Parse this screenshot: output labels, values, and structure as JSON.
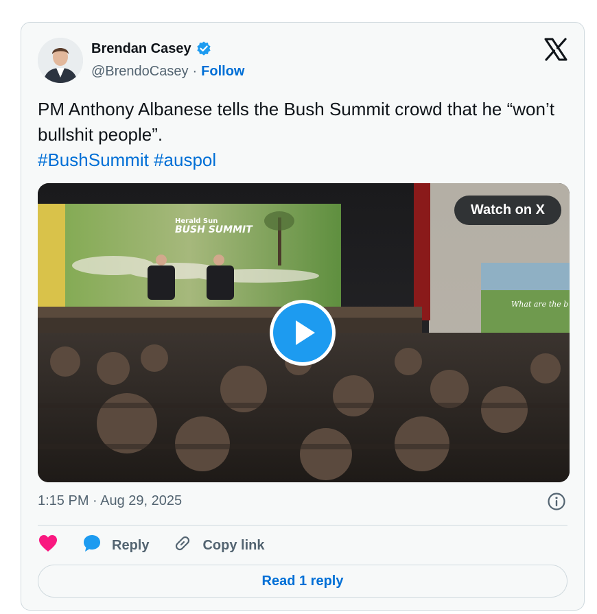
{
  "author": {
    "name": "Brendan Casey",
    "handle": "@BrendoCasey",
    "separator": "·",
    "follow_label": "Follow"
  },
  "tweet": {
    "text": "PM Anthony Albanese tells the Bush Summit crowd that he “won’t bullshit people”.",
    "hashtags": [
      "#BushSummit",
      "#auspol"
    ]
  },
  "media": {
    "watch_label": "Watch on X",
    "screen_title_small": "Herald Sun",
    "screen_title_big": "BUSH SUMMIT",
    "side_screen_text": "What are the b facing region"
  },
  "meta": {
    "timestamp": "1:15 PM · Aug 29, 2025"
  },
  "actions": {
    "reply_label": "Reply",
    "copy_label": "Copy link",
    "read_replies_label": "Read 1 reply"
  },
  "colors": {
    "accent": "#006fd6",
    "heart": "#f91880",
    "verified": "#1d9bf0",
    "play": "#1d9bf0"
  },
  "icons": [
    "verified-badge-icon",
    "x-logo-icon",
    "play-icon",
    "info-icon",
    "heart-icon",
    "reply-bubble-icon",
    "link-icon"
  ]
}
